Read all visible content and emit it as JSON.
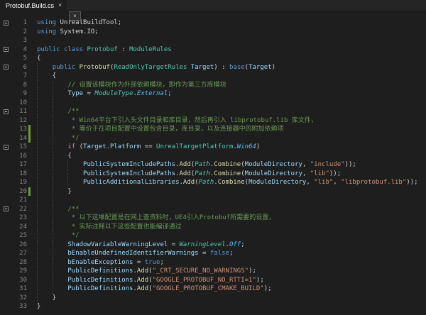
{
  "window": {
    "tab": {
      "title": "Protobuf.Build.cs",
      "close_glyph": "×"
    },
    "floating_close_glyph": "×"
  },
  "palette": {
    "editor_background": "#1e1e1e",
    "tabbar_background": "#252526",
    "tab_active_background": "#1e1e1e",
    "tab_title_color": "#ffffff",
    "line_number_color": "#858585",
    "indent_guide_color": "#404040",
    "git_added_color": "#6f9e2f",
    "tokens": {
      "k": "#569cd6",
      "c": "#c586c0",
      "t": "#4ec9b0",
      "ti": "#4ec9b0",
      "m": "#dcdcaa",
      "v": "#9cdcfe",
      "s": "#ce9178",
      "cm": "#6a9955",
      "p": "#d4d4d4",
      "e": "#4fc1ff"
    }
  },
  "editor": {
    "language": "csharp",
    "lines": [
      {
        "fold": true,
        "tokens": [
          [
            "using",
            "k"
          ],
          [
            " UnrealBuildTool;",
            "p"
          ]
        ]
      },
      {
        "tokens": [
          [
            "using",
            "k"
          ],
          [
            " System.IO;",
            "p"
          ]
        ]
      },
      {
        "tokens": []
      },
      {
        "fold": true,
        "tokens": [
          [
            "public",
            "k"
          ],
          [
            " ",
            "p"
          ],
          [
            "class",
            "k"
          ],
          [
            " ",
            "p"
          ],
          [
            "Protobuf",
            "t"
          ],
          [
            " : ",
            "p"
          ],
          [
            "ModuleRules",
            "t"
          ]
        ]
      },
      {
        "tokens": [
          [
            "{",
            "p"
          ]
        ]
      },
      {
        "fold": true,
        "tokens": [
          [
            "    ",
            "p"
          ],
          [
            "public",
            "k"
          ],
          [
            " ",
            "p"
          ],
          [
            "Protobuf",
            "m"
          ],
          [
            "(",
            "p"
          ],
          [
            "ReadOnlyTargetRules",
            "t"
          ],
          [
            " ",
            "p"
          ],
          [
            "Target",
            "v"
          ],
          [
            ") : ",
            "p"
          ],
          [
            "base",
            "k"
          ],
          [
            "(",
            "p"
          ],
          [
            "Target",
            "v"
          ],
          [
            ")",
            "p"
          ]
        ]
      },
      {
        "tokens": [
          [
            "    {",
            "p"
          ]
        ]
      },
      {
        "tokens": [
          [
            "        ",
            "p"
          ],
          [
            "// 设置该模块作为外部依赖模块，即作为第三方库模块",
            "cm"
          ]
        ]
      },
      {
        "tokens": [
          [
            "        ",
            "p"
          ],
          [
            "Type",
            "v"
          ],
          [
            " = ",
            "p"
          ],
          [
            "ModuleType",
            "ti"
          ],
          [
            ".",
            "p"
          ],
          [
            "External",
            "e"
          ],
          [
            ";",
            "p"
          ]
        ]
      },
      {
        "tokens": []
      },
      {
        "fold": true,
        "tokens": [
          [
            "        /**",
            "cm"
          ]
        ]
      },
      {
        "tokens": [
          [
            "         * Win64平台下引入头文件目录和库目录，然后再引入 libprotobuf.lib 库文件，",
            "cm"
          ]
        ]
      },
      {
        "git": true,
        "tokens": [
          [
            "         * 等价于在项目配置中设置包含目录，库目录，以及连接器中的附加依赖项",
            "cm"
          ]
        ]
      },
      {
        "git": true,
        "tokens": [
          [
            "         */",
            "cm"
          ]
        ]
      },
      {
        "fold": true,
        "tokens": [
          [
            "        ",
            "p"
          ],
          [
            "if",
            "c"
          ],
          [
            " (",
            "p"
          ],
          [
            "Target",
            "v"
          ],
          [
            ".",
            "p"
          ],
          [
            "Platform",
            "v"
          ],
          [
            " == ",
            "p"
          ],
          [
            "UnrealTargetPlatform",
            "t"
          ],
          [
            ".",
            "p"
          ],
          [
            "Win64",
            "e"
          ],
          [
            ")",
            "p"
          ]
        ]
      },
      {
        "tokens": [
          [
            "        {",
            "p"
          ]
        ]
      },
      {
        "tokens": [
          [
            "            ",
            "p"
          ],
          [
            "PublicSystemIncludePaths",
            "v"
          ],
          [
            ".",
            "p"
          ],
          [
            "Add",
            "m"
          ],
          [
            "(",
            "p"
          ],
          [
            "Path",
            "ti"
          ],
          [
            ".",
            "p"
          ],
          [
            "Combine",
            "m"
          ],
          [
            "(",
            "p"
          ],
          [
            "ModuleDirectory",
            "v"
          ],
          [
            ", ",
            "p"
          ],
          [
            "\"include\"",
            "s"
          ],
          [
            "));",
            "p"
          ]
        ]
      },
      {
        "tokens": [
          [
            "            ",
            "p"
          ],
          [
            "PublicSystemIncludePaths",
            "v"
          ],
          [
            ".",
            "p"
          ],
          [
            "Add",
            "m"
          ],
          [
            "(",
            "p"
          ],
          [
            "Path",
            "ti"
          ],
          [
            ".",
            "p"
          ],
          [
            "Combine",
            "m"
          ],
          [
            "(",
            "p"
          ],
          [
            "ModuleDirectory",
            "v"
          ],
          [
            ", ",
            "p"
          ],
          [
            "\"lib\"",
            "s"
          ],
          [
            "));",
            "p"
          ]
        ]
      },
      {
        "tokens": [
          [
            "            ",
            "p"
          ],
          [
            "PublicAdditionalLibraries",
            "v"
          ],
          [
            ".",
            "p"
          ],
          [
            "Add",
            "m"
          ],
          [
            "(",
            "p"
          ],
          [
            "Path",
            "ti"
          ],
          [
            ".",
            "p"
          ],
          [
            "Combine",
            "m"
          ],
          [
            "(",
            "p"
          ],
          [
            "ModuleDirectory",
            "v"
          ],
          [
            ", ",
            "p"
          ],
          [
            "\"lib\"",
            "s"
          ],
          [
            ", ",
            "p"
          ],
          [
            "\"libprotobuf.lib\"",
            "s"
          ],
          [
            "));",
            "p"
          ]
        ]
      },
      {
        "git": true,
        "tokens": [
          [
            "        }",
            "p"
          ]
        ]
      },
      {
        "tokens": []
      },
      {
        "fold": true,
        "tokens": [
          [
            "        /**",
            "cm"
          ]
        ]
      },
      {
        "tokens": [
          [
            "         * 以下这堆配置是在网上查资料时，UE4引入Protobuf所需要的设置，",
            "cm"
          ]
        ]
      },
      {
        "tokens": [
          [
            "         * 实际注释以下这些配置也能编译通过",
            "cm"
          ]
        ]
      },
      {
        "tokens": [
          [
            "         */",
            "cm"
          ]
        ]
      },
      {
        "tokens": [
          [
            "        ",
            "p"
          ],
          [
            "ShadowVariableWarningLevel",
            "v"
          ],
          [
            " = ",
            "p"
          ],
          [
            "WarningLevel",
            "ti"
          ],
          [
            ".",
            "p"
          ],
          [
            "Off",
            "e"
          ],
          [
            ";",
            "p"
          ]
        ]
      },
      {
        "tokens": [
          [
            "        ",
            "p"
          ],
          [
            "bEnableUndefinedIdentifierWarnings",
            "v"
          ],
          [
            " = ",
            "p"
          ],
          [
            "false",
            "k"
          ],
          [
            ";",
            "p"
          ]
        ]
      },
      {
        "tokens": [
          [
            "        ",
            "p"
          ],
          [
            "bEnableExceptions",
            "v"
          ],
          [
            " = ",
            "p"
          ],
          [
            "true",
            "k"
          ],
          [
            ";",
            "p"
          ]
        ]
      },
      {
        "tokens": [
          [
            "        ",
            "p"
          ],
          [
            "PublicDefinitions",
            "v"
          ],
          [
            ".",
            "p"
          ],
          [
            "Add",
            "m"
          ],
          [
            "(",
            "p"
          ],
          [
            "\"_CRT_SECURE_NO_WARNINGS\"",
            "s"
          ],
          [
            ");",
            "p"
          ]
        ]
      },
      {
        "tokens": [
          [
            "        ",
            "p"
          ],
          [
            "PublicDefinitions",
            "v"
          ],
          [
            ".",
            "p"
          ],
          [
            "Add",
            "m"
          ],
          [
            "(",
            "p"
          ],
          [
            "\"GOOGLE_PROTOBUF_NO_RTTI=1\"",
            "s"
          ],
          [
            ");",
            "p"
          ]
        ]
      },
      {
        "tokens": [
          [
            "        ",
            "p"
          ],
          [
            "PublicDefinitions",
            "v"
          ],
          [
            ".",
            "p"
          ],
          [
            "Add",
            "m"
          ],
          [
            "(",
            "p"
          ],
          [
            "\"GOOGLE_PROTOBUF_CMAKE_BUILD\"",
            "s"
          ],
          [
            ");",
            "p"
          ]
        ]
      },
      {
        "tokens": [
          [
            "    }",
            "p"
          ]
        ]
      },
      {
        "tokens": [
          [
            "}",
            "p"
          ]
        ]
      }
    ]
  }
}
